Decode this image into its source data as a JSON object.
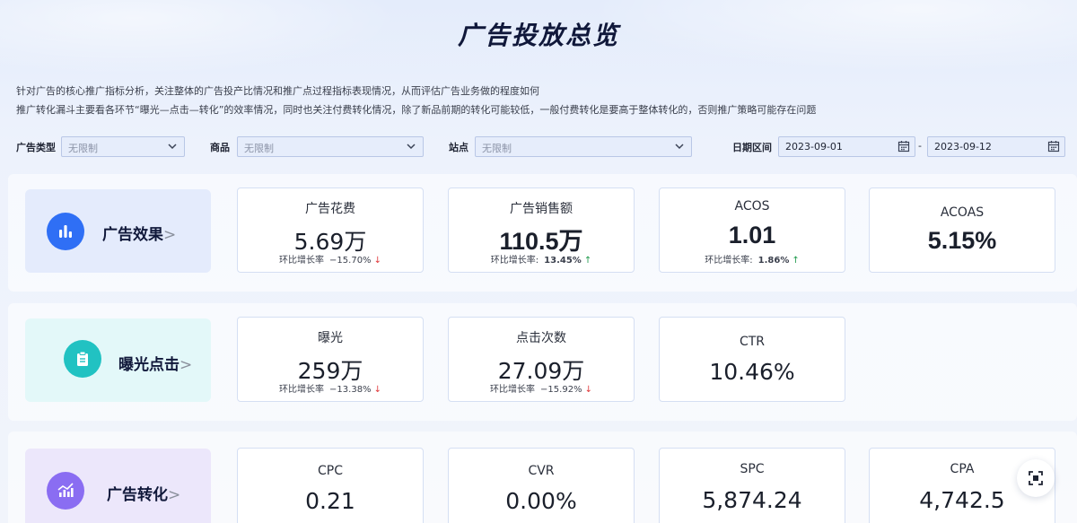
{
  "page": {
    "title": "广告投放总览",
    "description": [
      "针对广告的核心推广指标分析，关注整体的广告投产比情况和推广点过程指标表现情况，从而评估广告业务做的程度如何",
      "推广转化漏斗主要看各环节“曝光—点击—转化”的效率情况，同时也关注付费转化情况，除了新品前期的转化可能较低，一般付费转化是要高于整体转化的，否则推广策略可能存在问题"
    ]
  },
  "filters": {
    "ad_type": {
      "label": "广告类型",
      "value": "无限制"
    },
    "product": {
      "label": "商品",
      "value": "无限制"
    },
    "site": {
      "label": "站点",
      "value": "无限制"
    },
    "date_range": {
      "label": "日期区间",
      "start": "2023-09-01",
      "separator": "-",
      "end": "2023-09-12"
    }
  },
  "sections": {
    "effect": {
      "name": "广告效果",
      "arrow": ">",
      "icon": "bar-chart-icon",
      "color": "#2f6ff5",
      "cards": [
        {
          "title": "广告花费",
          "value": "5.69万",
          "growth_label": "环比增长率",
          "growth_value": "−15.70%",
          "direction": "down"
        },
        {
          "title": "广告销售额",
          "value": "110.5万",
          "growth_label": "环比增长率:",
          "growth_value": "13.45%",
          "direction": "up"
        },
        {
          "title": "ACOS",
          "value": "1.01",
          "growth_label": "环比增长率:",
          "growth_value": "1.86%",
          "direction": "up"
        },
        {
          "title": "ACOAS",
          "value": "5.15%"
        }
      ]
    },
    "exposure": {
      "name": "曝光点击",
      "arrow": ">",
      "icon": "clipboard-icon",
      "color": "#21c2c2",
      "cards": [
        {
          "title": "曝光",
          "value": "259万",
          "growth_label": "环比增长率",
          "growth_value": "−13.38%",
          "direction": "down"
        },
        {
          "title": "点击次数",
          "value": "27.09万",
          "growth_label": "环比增长率",
          "growth_value": "−15.92%",
          "direction": "down"
        },
        {
          "title": "CTR",
          "value": "10.46%"
        }
      ]
    },
    "conversion": {
      "name": "广告转化",
      "arrow": ">",
      "icon": "trend-chart-icon",
      "color": "#8a6df2",
      "cards": [
        {
          "title": "CPC",
          "value": "0.21"
        },
        {
          "title": "CVR",
          "value": "0.00%"
        },
        {
          "title": "SPC",
          "value": "5,874.24"
        },
        {
          "title": "CPA",
          "value": "4,742.5"
        }
      ]
    }
  },
  "floating_button": {
    "icon": "fullscreen-icon"
  }
}
